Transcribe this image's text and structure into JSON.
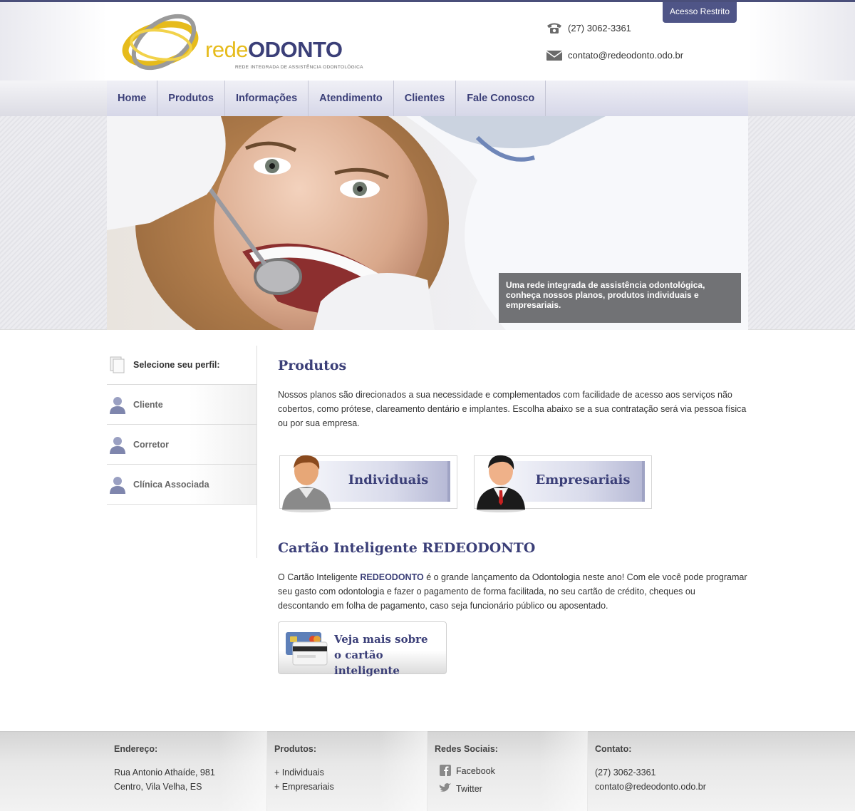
{
  "header": {
    "logo_word_1": "rede",
    "logo_word_2": "ODONTO",
    "logo_tagline": "REDE INTEGRADA DE ASSISTÊNCIA ODONTOLÓGICA",
    "restricted_label": "Acesso Restrito",
    "phone": "(27) 3062-3361",
    "email": "contato@redeodonto.odo.br"
  },
  "nav": {
    "items": [
      "Home",
      "Produtos",
      "Informações",
      "Atendimento",
      "Clientes",
      "Fale Conosco"
    ]
  },
  "banner": {
    "caption": "Uma rede integrada de assistência odontológica, conheça nossos planos, produtos individuais e empresariais."
  },
  "sidebar": {
    "heading": "Selecione seu perfil:",
    "items": [
      "Cliente",
      "Corretor",
      "Clínica Associada"
    ]
  },
  "products": {
    "title": "Produtos",
    "text": "Nossos planos são direcionados a sua necessidade e complementados com facilidade de acesso aos serviços não cobertos, como prótese, clareamento dentário e implantes. Escolha abaixo se a sua contratação será via pessoa física ou por sua empresa.",
    "individual_label": "Individuais",
    "business_label": "Empresariais"
  },
  "card": {
    "title": "Cartão Inteligente REDEODONTO",
    "text_before": "O Cartão Inteligente ",
    "brand": "REDEODONTO",
    "text_after": " é o grande lançamento da Odontologia neste ano! Com ele você pode programar seu gasto com odontologia e fazer o pagamento de forma facilitada, no seu cartão de crédito, cheques ou descontando em folha de pagamento, caso seja funcionário público ou aposentado.",
    "button_line1": "Veja mais sobre",
    "button_line2": "o cartão inteligente"
  },
  "footer": {
    "address": {
      "title": "Endereço:",
      "line1": "Rua Antonio Athaíde, 981",
      "line2": "Centro, Vila Velha, ES"
    },
    "products": {
      "title": "Produtos:",
      "items": [
        "+ Individuais",
        "+ Empresariais"
      ]
    },
    "social": {
      "title": "Redes Sociais:",
      "items": [
        "Facebook",
        "Twitter"
      ]
    },
    "contact": {
      "title": "Contato:",
      "phone": "(27) 3062-3361",
      "email": "contato@redeodonto.odo.br"
    }
  },
  "colors": {
    "brand_navy": "#3b3f78",
    "brand_gold": "#e6bb1b",
    "restricted_bg": "#4f5587"
  }
}
